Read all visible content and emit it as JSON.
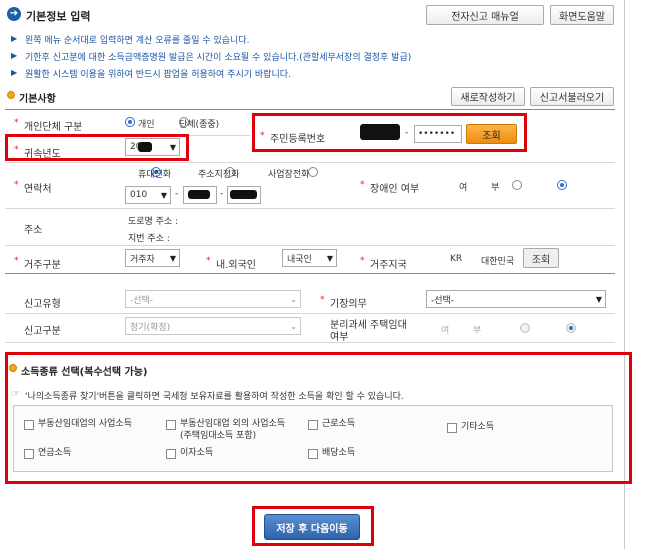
{
  "header": {
    "title_icon": "arrow-right-circle-icon",
    "title": "기본정보 입력",
    "manual_button": "전자신고 매뉴얼",
    "help_button": "화면도움말"
  },
  "notices": [
    "왼쪽 메뉴 순서대로 입력하면 계산 오류를 줄일 수 있습니다.",
    "기한후 신고분에 대한 소득금액증명원 발급은 시간이 소요될 수 있습니다.(관할세무서장의 결정후 발급)",
    "원활한 시스템 이용을 위하여 반드시 팝업을 허용하여 주시기 바랍니다."
  ],
  "basic": {
    "section_title": "기본사항",
    "new_button": "새로작성하기",
    "load_button": "신고서불러오기",
    "taxpayer_type": {
      "label": "개인단체 구분",
      "options": [
        "개인",
        "단체(종중)"
      ],
      "selected": "개인"
    },
    "resident_no": {
      "label": "주민등록번호",
      "dash": "-",
      "masked_back": "•••••••",
      "lookup_button": "조회"
    },
    "year": {
      "label": "귀속년도",
      "value": "20"
    },
    "contact": {
      "label": "연락처",
      "options": [
        "휴대전화",
        "주소지전화",
        "사업장전화"
      ],
      "selected": "휴대전화",
      "prefix": "010",
      "dash": "-"
    },
    "disabled": {
      "label": "장애인 여부",
      "options": [
        "여",
        "부"
      ],
      "selected": "부"
    },
    "address": {
      "label": "주소",
      "road": "도로명 주소 :",
      "lot": "지번 주소 :"
    },
    "residence": {
      "label": "거주구분",
      "value": "거주자"
    },
    "nationality": {
      "label": "내.외국인",
      "value": "내국인"
    },
    "region": {
      "label": "거주지국",
      "code": "KR",
      "name": "대한민국",
      "lookup_button": "조회"
    },
    "filing_type": {
      "label": "신고유형",
      "value": "-선택-"
    },
    "bookkeeping": {
      "label": "기장의무",
      "value": "-선택-"
    },
    "filing_category": {
      "label": "신고구분",
      "value": "정기(확정)"
    },
    "separate_tax": {
      "label_line1": "분리과세 주택임대",
      "label_line2": "여부",
      "options": [
        "여",
        "부"
      ],
      "selected": "부"
    }
  },
  "income": {
    "section_title": "소득종류 선택(복수선택 가능)",
    "hint_icon": "pointing-hand-icon",
    "hint": "'나의소득종류 찾기'버튼을 클릭하면 국세청 보유자료를 활용하여 작성한 소득을 확인 할 수 있습니다.",
    "items": [
      {
        "label": "부동산임대업의 사업소득"
      },
      {
        "label": "부동산임대업 외의 사업소득",
        "sub": "(주택임대소득 포함)"
      },
      {
        "label": "근로소득"
      },
      {
        "label": "기타소득"
      },
      {
        "label": "연금소득"
      },
      {
        "label": "이자소득"
      },
      {
        "label": "배당소득"
      }
    ]
  },
  "footer": {
    "save_button": "저장 후 다음이동"
  },
  "colors": {
    "highlight": "#e0000b",
    "accent_blue": "#1d5fa8",
    "notice_blue": "#1b55a6",
    "lookup_orange": "#f39c12",
    "save_blue": "#3a72b8"
  }
}
